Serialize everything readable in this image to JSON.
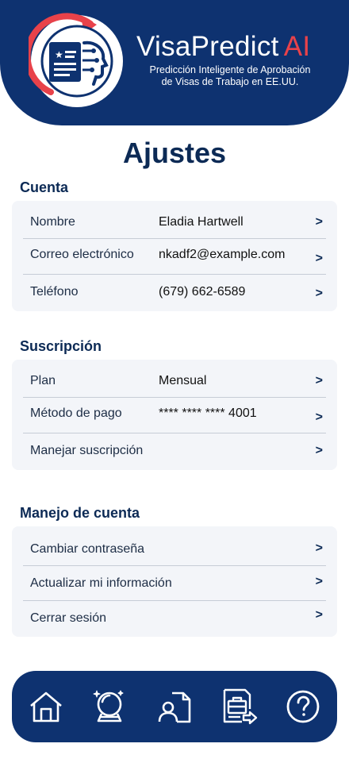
{
  "header": {
    "brand_name": "VisaPredict",
    "brand_ai": "AI",
    "tagline_line1": "Predicción Inteligente de Aprobación",
    "tagline_line2": "de Visas de Trabajo en EE.UU.",
    "colors": {
      "primary": "#0e3270",
      "accent": "#e8424a"
    },
    "logo_icon": "document-with-ai-head-logo"
  },
  "page": {
    "title": "Ajustes"
  },
  "sections": {
    "cuenta": {
      "title": "Cuenta",
      "rows": [
        {
          "label": "Nombre",
          "value": "Eladia Hartwell",
          "chevron": ">"
        },
        {
          "label": "Correo electrónico",
          "value": "nkadf2@example.com",
          "chevron": ">"
        },
        {
          "label": "Teléfono",
          "value": "(679) 662-6589",
          "chevron": ">"
        }
      ]
    },
    "suscripcion": {
      "title": "Suscripción",
      "rows": [
        {
          "label": "Plan",
          "value": "Mensual",
          "chevron": ">"
        },
        {
          "label": "Método de pago",
          "value": "**** **** **** 4001",
          "chevron": ">"
        },
        {
          "label": "Manejar suscripción",
          "chevron": ">"
        }
      ]
    },
    "manejo": {
      "title": "Manejo de cuenta",
      "rows": [
        {
          "label": "Cambiar contraseña",
          "chevron": ">"
        },
        {
          "label": "Actualizar mi información",
          "chevron": ">"
        },
        {
          "label": "Cerrar sesión",
          "chevron": ">"
        }
      ]
    }
  },
  "nav": {
    "icons": [
      "home-icon",
      "crystal-ball-icon",
      "profile-document-icon",
      "briefcase-document-icon",
      "help-icon"
    ]
  }
}
